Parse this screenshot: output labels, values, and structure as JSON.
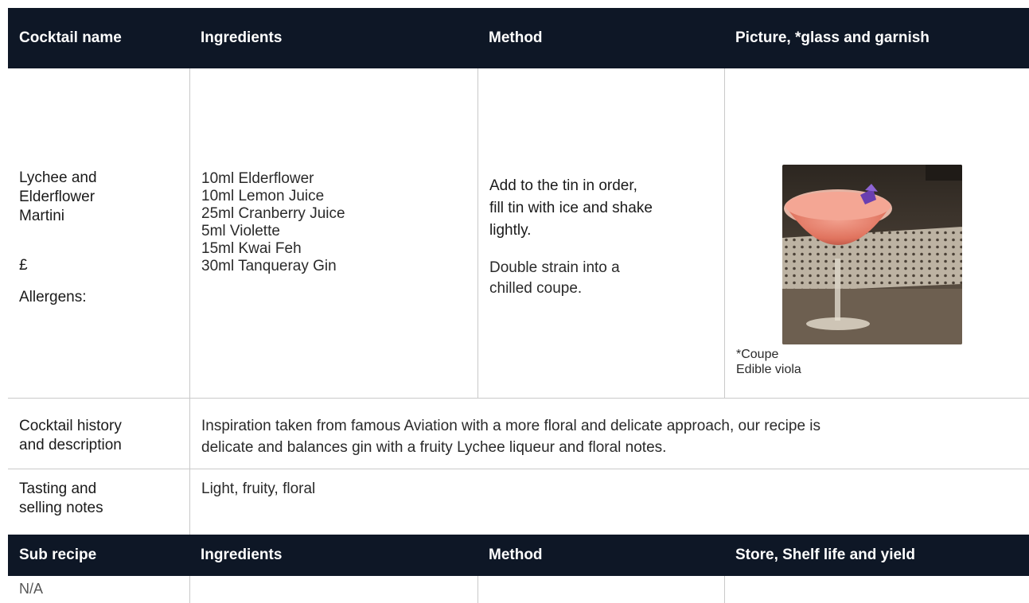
{
  "header": {
    "col1": "Cocktail name",
    "col2": "Ingredients",
    "col3": "Method",
    "col4": "Picture, *glass and garnish"
  },
  "cocktail": {
    "name_lines": [
      "Lychee and",
      "Elderflower",
      "Martini"
    ],
    "price": "£",
    "allergens": "Allergens:",
    "ingredients": [
      "10ml Elderflower",
      "10ml Lemon Juice",
      "25ml Cranberry Juice",
      "5ml Violette",
      "15ml Kwai Feh",
      "30ml Tanqueray Gin"
    ],
    "method_step1_lines": [
      "Add to the tin in order,",
      "fill tin with ice and shake",
      "lightly."
    ],
    "method_step2_lines": [
      "Double strain into a",
      "chilled coupe."
    ],
    "glass": "*Coupe",
    "garnish": "Edible viola"
  },
  "history": {
    "label_lines": [
      "Cocktail history",
      "and description"
    ],
    "text_lines": [
      "Inspiration taken from famous Aviation with a more floral and delicate approach, our recipe is",
      "delicate and balances gin with a fruity Lychee liqueur and floral notes."
    ]
  },
  "tasting": {
    "label_lines": [
      "Tasting and",
      "selling notes"
    ],
    "text": "Light, fruity, floral"
  },
  "sub_header": {
    "col1": "Sub recipe",
    "col2": "Ingredients",
    "col3": "Method",
    "col4": "Store, Shelf life and yield"
  },
  "sub_recipe": {
    "name": "N/A"
  },
  "colors": {
    "header_bg": "#0e1726",
    "rule": "#c9c9c9"
  }
}
